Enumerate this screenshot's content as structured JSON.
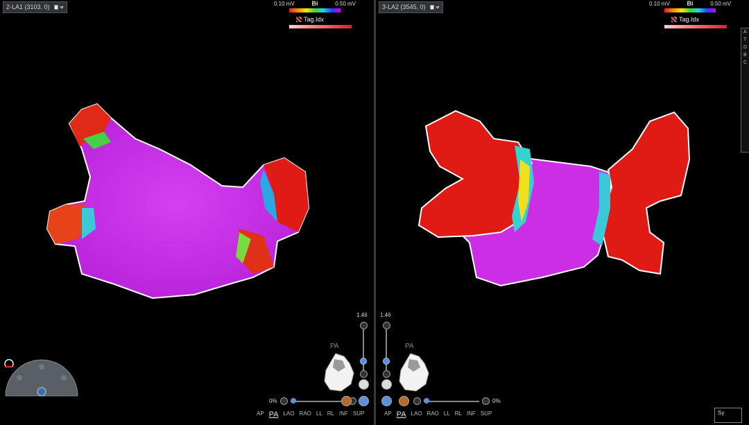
{
  "left_map": {
    "title": "2-LA1 (3103, 0)",
    "scale_min": "0.10 mV",
    "scale_max": "0.50 mV",
    "scale_label": "Bi",
    "tag_label": "Tag.Idx",
    "view_label": "PA",
    "zoom_value": "1.46",
    "opacity_value": "0%",
    "view_buttons": [
      "AP",
      "PA",
      "LAO",
      "RAO",
      "LL",
      "RL",
      "INF",
      "SUP"
    ],
    "active_view": "PA"
  },
  "right_map": {
    "title": "3-LA2 (3545, 0)",
    "scale_min": "0.10 mV",
    "scale_max": "0.50 mV",
    "scale_label": "Bi",
    "tag_label": "Tag.Idx",
    "view_label": "PA",
    "zoom_value": "1.46",
    "opacity_value": "0%",
    "view_buttons": [
      "AP",
      "PA",
      "LAO",
      "RAO",
      "LL",
      "RL",
      "INF",
      "SUP"
    ],
    "active_view": "PA"
  },
  "side_panel": {
    "lines": [
      "A",
      "T",
      "D",
      "B",
      "C"
    ]
  },
  "sy_box": {
    "label": "Sy"
  },
  "colors": {
    "magenta": "#cc2ee6",
    "red": "#e01a14",
    "accent": "#5b8fd8"
  }
}
